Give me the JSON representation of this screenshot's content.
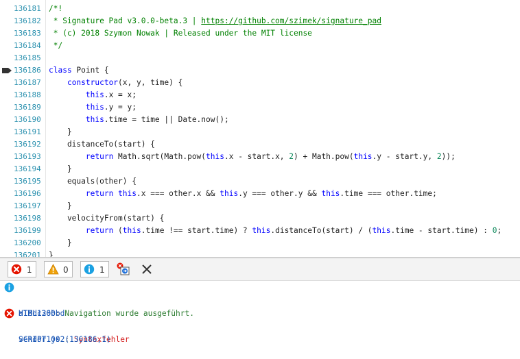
{
  "editor": {
    "lines": [
      {
        "num": "136181",
        "segs": [
          {
            "t": "/*!",
            "c": "cm"
          }
        ]
      },
      {
        "num": "136182",
        "segs": [
          {
            "t": " * Signature Pad v3.0.0-beta.3 | ",
            "c": "cm"
          },
          {
            "t": "https://github.com/szimek/signature_pad",
            "c": "url"
          }
        ]
      },
      {
        "num": "136183",
        "segs": [
          {
            "t": " * (c) 2018 Szymon Nowak | Released under the MIT license",
            "c": "cm"
          }
        ]
      },
      {
        "num": "136184",
        "segs": [
          {
            "t": " */",
            "c": "cm"
          }
        ]
      },
      {
        "num": "136185",
        "segs": []
      },
      {
        "num": "136186",
        "segs": [
          {
            "t": "class",
            "c": "kw"
          },
          {
            "t": " Point {",
            "c": ""
          }
        ],
        "marker": true
      },
      {
        "num": "136187",
        "segs": [
          {
            "t": "    ",
            "c": ""
          },
          {
            "t": "constructor",
            "c": "kw"
          },
          {
            "t": "(x, y, time) {",
            "c": ""
          }
        ]
      },
      {
        "num": "136188",
        "segs": [
          {
            "t": "        ",
            "c": ""
          },
          {
            "t": "this",
            "c": "kw"
          },
          {
            "t": ".x = x;",
            "c": ""
          }
        ]
      },
      {
        "num": "136189",
        "segs": [
          {
            "t": "        ",
            "c": ""
          },
          {
            "t": "this",
            "c": "kw"
          },
          {
            "t": ".y = y;",
            "c": ""
          }
        ]
      },
      {
        "num": "136190",
        "segs": [
          {
            "t": "        ",
            "c": ""
          },
          {
            "t": "this",
            "c": "kw"
          },
          {
            "t": ".time = time || Date.now();",
            "c": ""
          }
        ]
      },
      {
        "num": "136191",
        "segs": [
          {
            "t": "    }",
            "c": ""
          }
        ]
      },
      {
        "num": "136192",
        "segs": [
          {
            "t": "    distanceTo(start) {",
            "c": ""
          }
        ]
      },
      {
        "num": "136193",
        "segs": [
          {
            "t": "        ",
            "c": ""
          },
          {
            "t": "return",
            "c": "kw"
          },
          {
            "t": " Math.sqrt(Math.pow(",
            "c": ""
          },
          {
            "t": "this",
            "c": "kw"
          },
          {
            "t": ".x - start.x, ",
            "c": ""
          },
          {
            "t": "2",
            "c": "num"
          },
          {
            "t": ") + Math.pow(",
            "c": ""
          },
          {
            "t": "this",
            "c": "kw"
          },
          {
            "t": ".y - start.y, ",
            "c": ""
          },
          {
            "t": "2",
            "c": "num"
          },
          {
            "t": "));",
            "c": ""
          }
        ]
      },
      {
        "num": "136194",
        "segs": [
          {
            "t": "    }",
            "c": ""
          }
        ]
      },
      {
        "num": "136195",
        "segs": [
          {
            "t": "    equals(other) {",
            "c": ""
          }
        ]
      },
      {
        "num": "136196",
        "segs": [
          {
            "t": "        ",
            "c": ""
          },
          {
            "t": "return",
            "c": "kw"
          },
          {
            "t": " ",
            "c": ""
          },
          {
            "t": "this",
            "c": "kw"
          },
          {
            "t": ".x === other.x && ",
            "c": ""
          },
          {
            "t": "this",
            "c": "kw"
          },
          {
            "t": ".y === other.y && ",
            "c": ""
          },
          {
            "t": "this",
            "c": "kw"
          },
          {
            "t": ".time === other.time;",
            "c": ""
          }
        ]
      },
      {
        "num": "136197",
        "segs": [
          {
            "t": "    }",
            "c": ""
          }
        ]
      },
      {
        "num": "136198",
        "segs": [
          {
            "t": "    velocityFrom(start) {",
            "c": ""
          }
        ]
      },
      {
        "num": "136199",
        "segs": [
          {
            "t": "        ",
            "c": ""
          },
          {
            "t": "return",
            "c": "kw"
          },
          {
            "t": " (",
            "c": ""
          },
          {
            "t": "this",
            "c": "kw"
          },
          {
            "t": ".time !== start.time) ? ",
            "c": ""
          },
          {
            "t": "this",
            "c": "kw"
          },
          {
            "t": ".distanceTo(start) / (",
            "c": ""
          },
          {
            "t": "this",
            "c": "kw"
          },
          {
            "t": ".time - start.time) : ",
            "c": ""
          },
          {
            "t": "0",
            "c": "num"
          },
          {
            "t": ";",
            "c": ""
          }
        ]
      },
      {
        "num": "136200",
        "segs": [
          {
            "t": "    }",
            "c": ""
          }
        ]
      },
      {
        "num": "136201",
        "segs": [
          {
            "t": "}",
            "c": ""
          }
        ]
      }
    ]
  },
  "toolbar": {
    "errors_count": "1",
    "warnings_count": "0",
    "info_count": "1",
    "filter_icon": "clear-on-navigate-icon",
    "clear_icon": "close-icon"
  },
  "console": {
    "messages": [
      {
        "type": "info",
        "code": "HTML1300",
        "sep": ": ",
        "text": "Navigation wurde ausgeführt.",
        "source": "a18dc26bbd"
      },
      {
        "type": "error",
        "code": "SCRIPT1002",
        "sep": ": ",
        "text": "Syntaxfehler",
        "source": "vendor.js (136186,1)"
      }
    ]
  },
  "colors": {
    "line_numbers": "#2b91af",
    "keyword": "#0000ff",
    "comment": "#008000",
    "error": "#d41f1f",
    "info": "#1a56b5"
  }
}
